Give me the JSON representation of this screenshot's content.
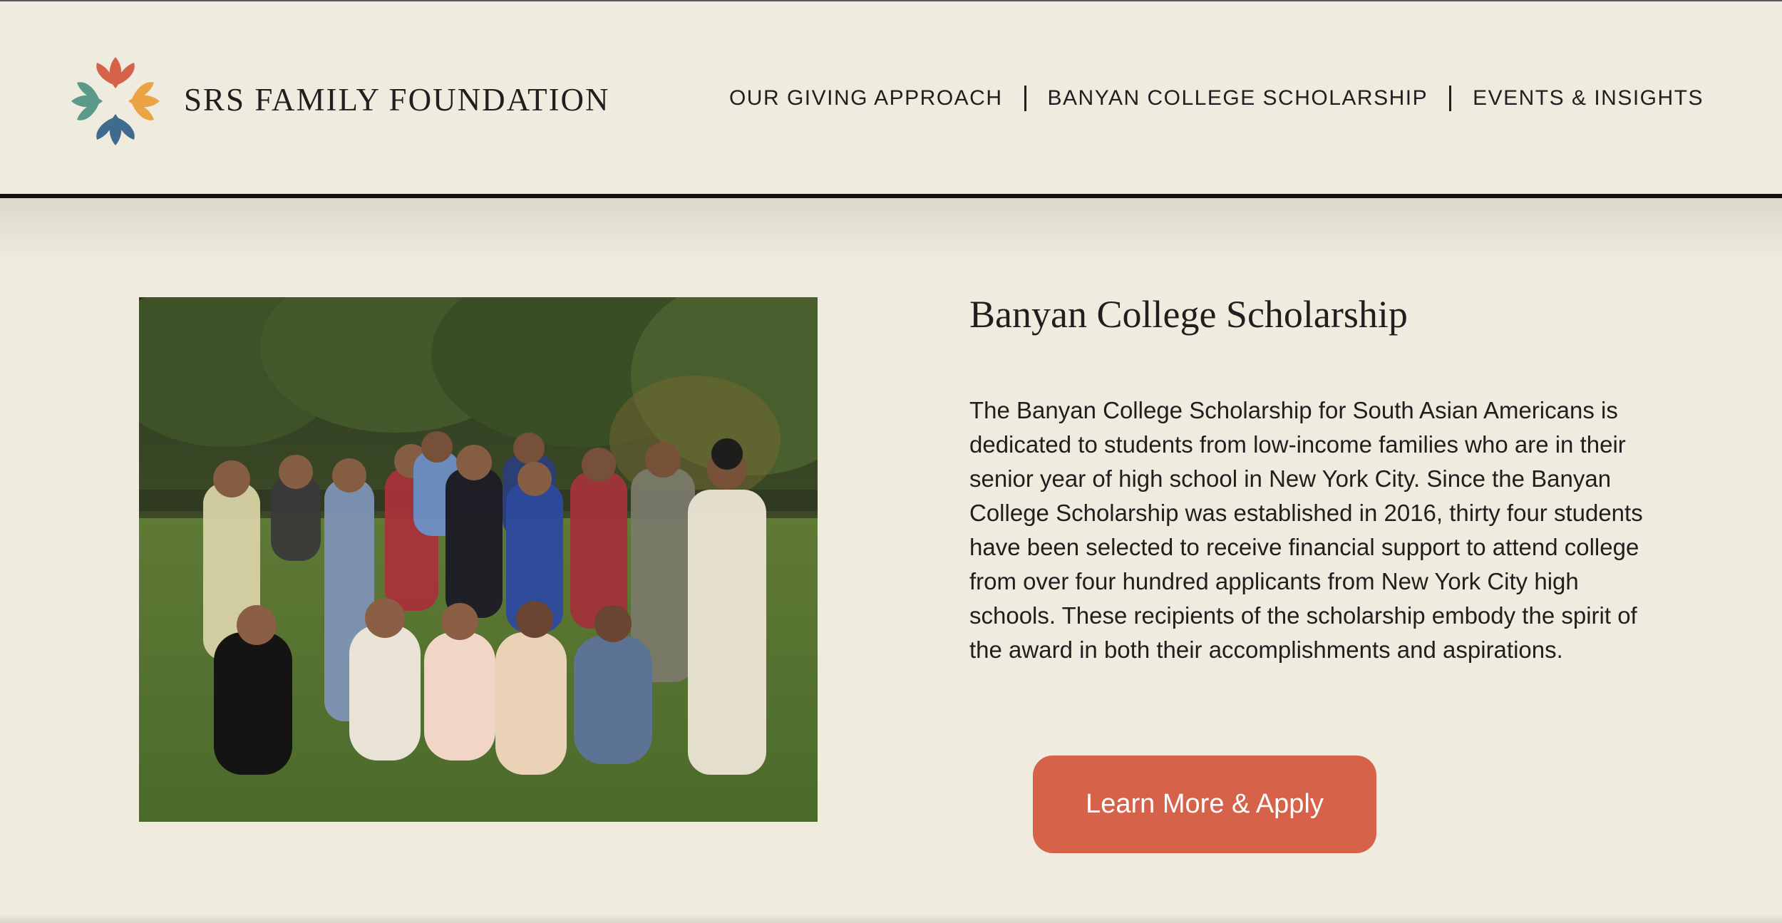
{
  "header": {
    "brand": "SRS FAMILY FOUNDATION",
    "logo_icon": "lotus-flower-icon",
    "nav": [
      {
        "label": "OUR GIVING APPROACH"
      },
      {
        "label": "BANYAN COLLEGE SCHOLARSHIP"
      },
      {
        "label": "EVENTS & INSIGHTS"
      }
    ]
  },
  "hero": {
    "title": "Banyan College Scholarship",
    "body": "The Banyan College Scholarship for South Asian Americans is dedicated to students from low-income families who are in their senior year of high school in New York City.  Since the Banyan College Scholarship was established in 2016, thirty four students have been selected to receive financial support to attend college from over four hundred applicants from New York City high schools. These recipients of the scholarship embody the spirit of the award in both their accomplishments and aspirations.",
    "cta_label": "Learn More & Apply",
    "photo_icon": "group-photo-image"
  },
  "colors": {
    "background": "#f0ebdf",
    "accent": "#d6624a",
    "text": "#1f1f1f"
  }
}
